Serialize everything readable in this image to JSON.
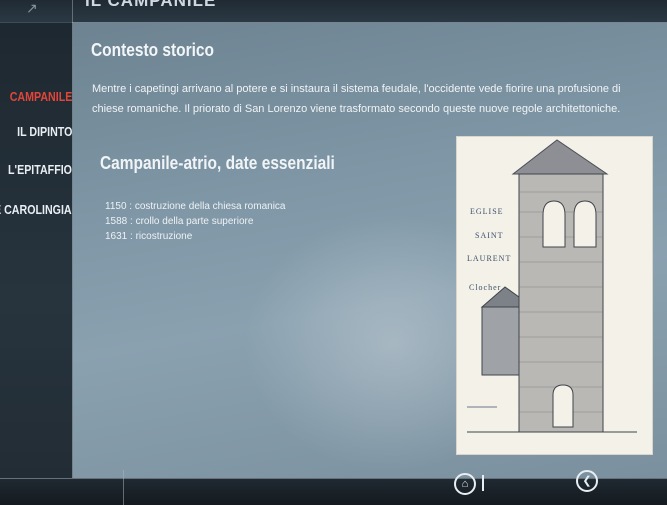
{
  "header": {
    "title": "IL CAMPANILE",
    "logo_icon": "logo-icon"
  },
  "sidebar": {
    "items": [
      {
        "label": "CAMPANILE",
        "active": true
      },
      {
        "label": "IL DIPINTO",
        "active": false
      },
      {
        "label": "L'EPITAFFIO",
        "active": false
      },
      {
        "label": "E CAROLINGIA",
        "active": false
      }
    ]
  },
  "main": {
    "section1_title": "Contesto storico",
    "section1_text": "Mentre i capetingi arrivano al potere e si instaura il sistema feudale, l'occidente vede fiorire una profusione di chiese romaniche. Il priorato di San Lorenzo viene trasformato secondo queste nuove regole architettoniche.",
    "section2_title": "Campanile-atrio, date essenziali",
    "timeline": [
      "1150 : costruzione della chiesa romanica",
      "1588 : crollo della parte superiore",
      "1631 : ricostruzione"
    ],
    "image": {
      "caption_lines": [
        "EGLISE",
        "SAINT",
        "LAURENT",
        "Clocher"
      ]
    }
  },
  "footer": {
    "home_icon": "home-icon",
    "back_icon": "back-icon"
  },
  "colors": {
    "active_nav": "#e2453a",
    "panel": "#7e96a5",
    "sidebar": "#1e2830"
  }
}
